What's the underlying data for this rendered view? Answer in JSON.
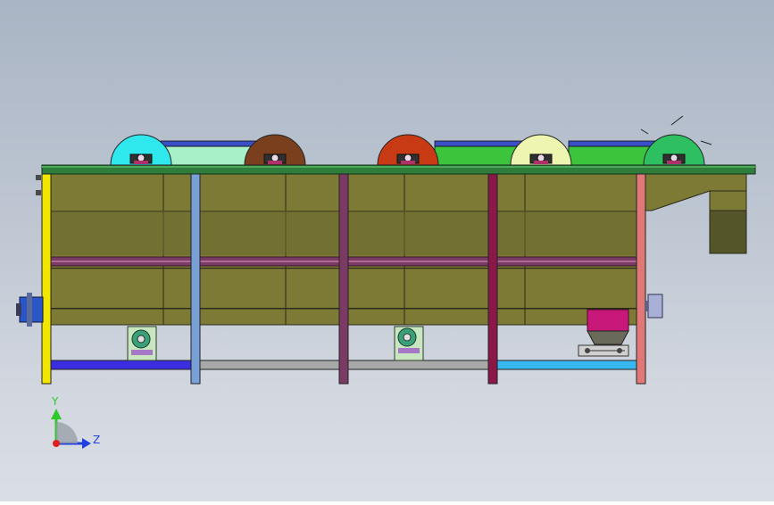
{
  "viewport": {
    "background_top": "#a9b4c4",
    "background_bottom": "#dadee5"
  },
  "model": {
    "top_plate_color": "#2e7d3a",
    "body_color": "#7d7a36",
    "body_dark_color": "#55552a",
    "rail_color": "#7a3a64",
    "roller_colors": [
      "#2ee8ee",
      "#7a3f1c",
      "#c73a14",
      "#eef5b0",
      "#2ec060"
    ],
    "belt_colors": [
      "#a8f0c8",
      "#3cc43c",
      "#3cc43c"
    ],
    "leg_colors": [
      "#f2e600",
      "#7aa0d8",
      "#7a3a64",
      "#8a1848",
      "#e07878"
    ],
    "base_bar_colors": [
      "#3a2ee0",
      "#a8a8a8",
      "#a8a8a8",
      "#38b8f0"
    ],
    "hopper_color": "#c8187a"
  },
  "triad": {
    "y_label": "Y",
    "z_label": "Z",
    "y_color": "#2cc82c",
    "z_color": "#2040e0",
    "origin_color": "#e02020"
  }
}
